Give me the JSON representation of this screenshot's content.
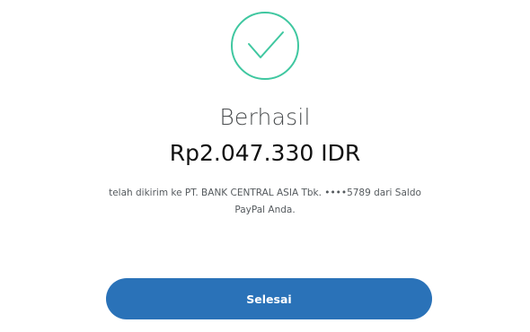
{
  "status": {
    "icon": "check-circle-icon",
    "icon_color": "#3fc7a0",
    "title": "Berhasil"
  },
  "transfer": {
    "amount": "Rp2.047.330 IDR",
    "description": "telah dikirim ke PT. BANK CENTRAL ASIA Tbk. ••••5789 dari Saldo PayPal Anda."
  },
  "actions": {
    "done_label": "Selesai",
    "button_color": "#2a72b8"
  }
}
